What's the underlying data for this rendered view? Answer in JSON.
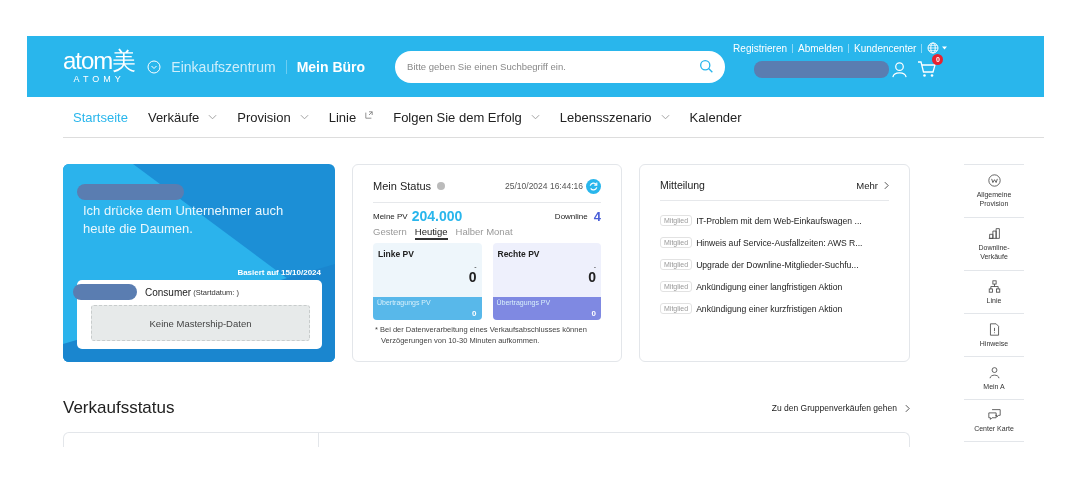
{
  "header": {
    "logo": "atom美",
    "logo_sub": "ATOMY",
    "sections": [
      {
        "label": "Einkaufszentrum",
        "selected": false
      },
      {
        "label": "Mein Büro",
        "selected": true
      }
    ],
    "search": {
      "placeholder": "Bitte geben Sie einen Suchbegriff ein."
    },
    "top_links": [
      "Registrieren",
      "Abmelden",
      "Kundencenter"
    ],
    "cart_count": "0"
  },
  "nav": [
    {
      "label": "Startseite",
      "selected": true,
      "kind": "plain"
    },
    {
      "label": "Verkäufe",
      "selected": false,
      "kind": "dropdown"
    },
    {
      "label": "Provision",
      "selected": false,
      "kind": "dropdown"
    },
    {
      "label": "Linie",
      "selected": false,
      "kind": "external"
    },
    {
      "label": "Folgen Sie dem Erfolg",
      "selected": false,
      "kind": "dropdown"
    },
    {
      "label": "Lebensszenario",
      "selected": false,
      "kind": "dropdown"
    },
    {
      "label": "Kalender",
      "selected": false,
      "kind": "plain"
    }
  ],
  "profile": {
    "message": "Ich drücke dem Unternehmer auch heute die Daumen.",
    "based_on": "Basiert auf 15/10/2024",
    "rank": "Consumer",
    "start_date": "(Startdatum: )",
    "mastership": "Keine Mastership-Daten"
  },
  "status": {
    "title": "Mein Status",
    "datetime": "25/10/2024 16:44:16",
    "my_pv_label": "Meine PV",
    "my_pv": "204.000",
    "downline_label": "Downline",
    "downline": "4",
    "tabs": [
      {
        "label": "Gestern",
        "selected": false
      },
      {
        "label": "Heutige",
        "selected": true
      },
      {
        "label": "Halber Monat",
        "selected": false
      }
    ],
    "boxes": [
      {
        "kind": "left",
        "title": "Linke PV",
        "dash": "-",
        "value": "0",
        "transfer_label": "Übertragungs PV",
        "transfer_value": "0"
      },
      {
        "kind": "right",
        "title": "Rechte PV",
        "dash": "-",
        "value": "0",
        "transfer_label": "Übertragungs PV",
        "transfer_value": "0"
      }
    ],
    "note": "* Bei der Datenverarbeitung eines Verkaufsabschlusses können Verzögerungen von 10-30 Minuten aufkommen."
  },
  "notices": {
    "title": "Mitteilung",
    "more": "Mehr",
    "items": [
      {
        "tag": "Mitglied",
        "text": "IT-Problem mit dem Web-Einkaufswagen ..."
      },
      {
        "tag": "Mitglied",
        "text": "Hinweis auf Service-Ausfallzeiten: AWS R..."
      },
      {
        "tag": "Mitglied",
        "text": "Upgrade der Downline-Mitglieder-Suchfu..."
      },
      {
        "tag": "Mitglied",
        "text": "Ankündigung einer langfristigen Aktion"
      },
      {
        "tag": "Mitglied",
        "text": "Ankündigung einer kurzfristigen Aktion"
      }
    ]
  },
  "sales": {
    "title": "Verkaufsstatus",
    "link": "Zu den Gruppenverkäufen gehen"
  },
  "quick_menu": [
    {
      "kind": "commission",
      "label": "Allgemeine Provision"
    },
    {
      "kind": "sales",
      "label": "Downline-Verkäufe"
    },
    {
      "kind": "line",
      "label": "Linie"
    },
    {
      "kind": "notes",
      "label": "Hinweise"
    },
    {
      "kind": "account",
      "label": "Mein A"
    },
    {
      "kind": "center",
      "label": "Center Karte"
    }
  ]
}
